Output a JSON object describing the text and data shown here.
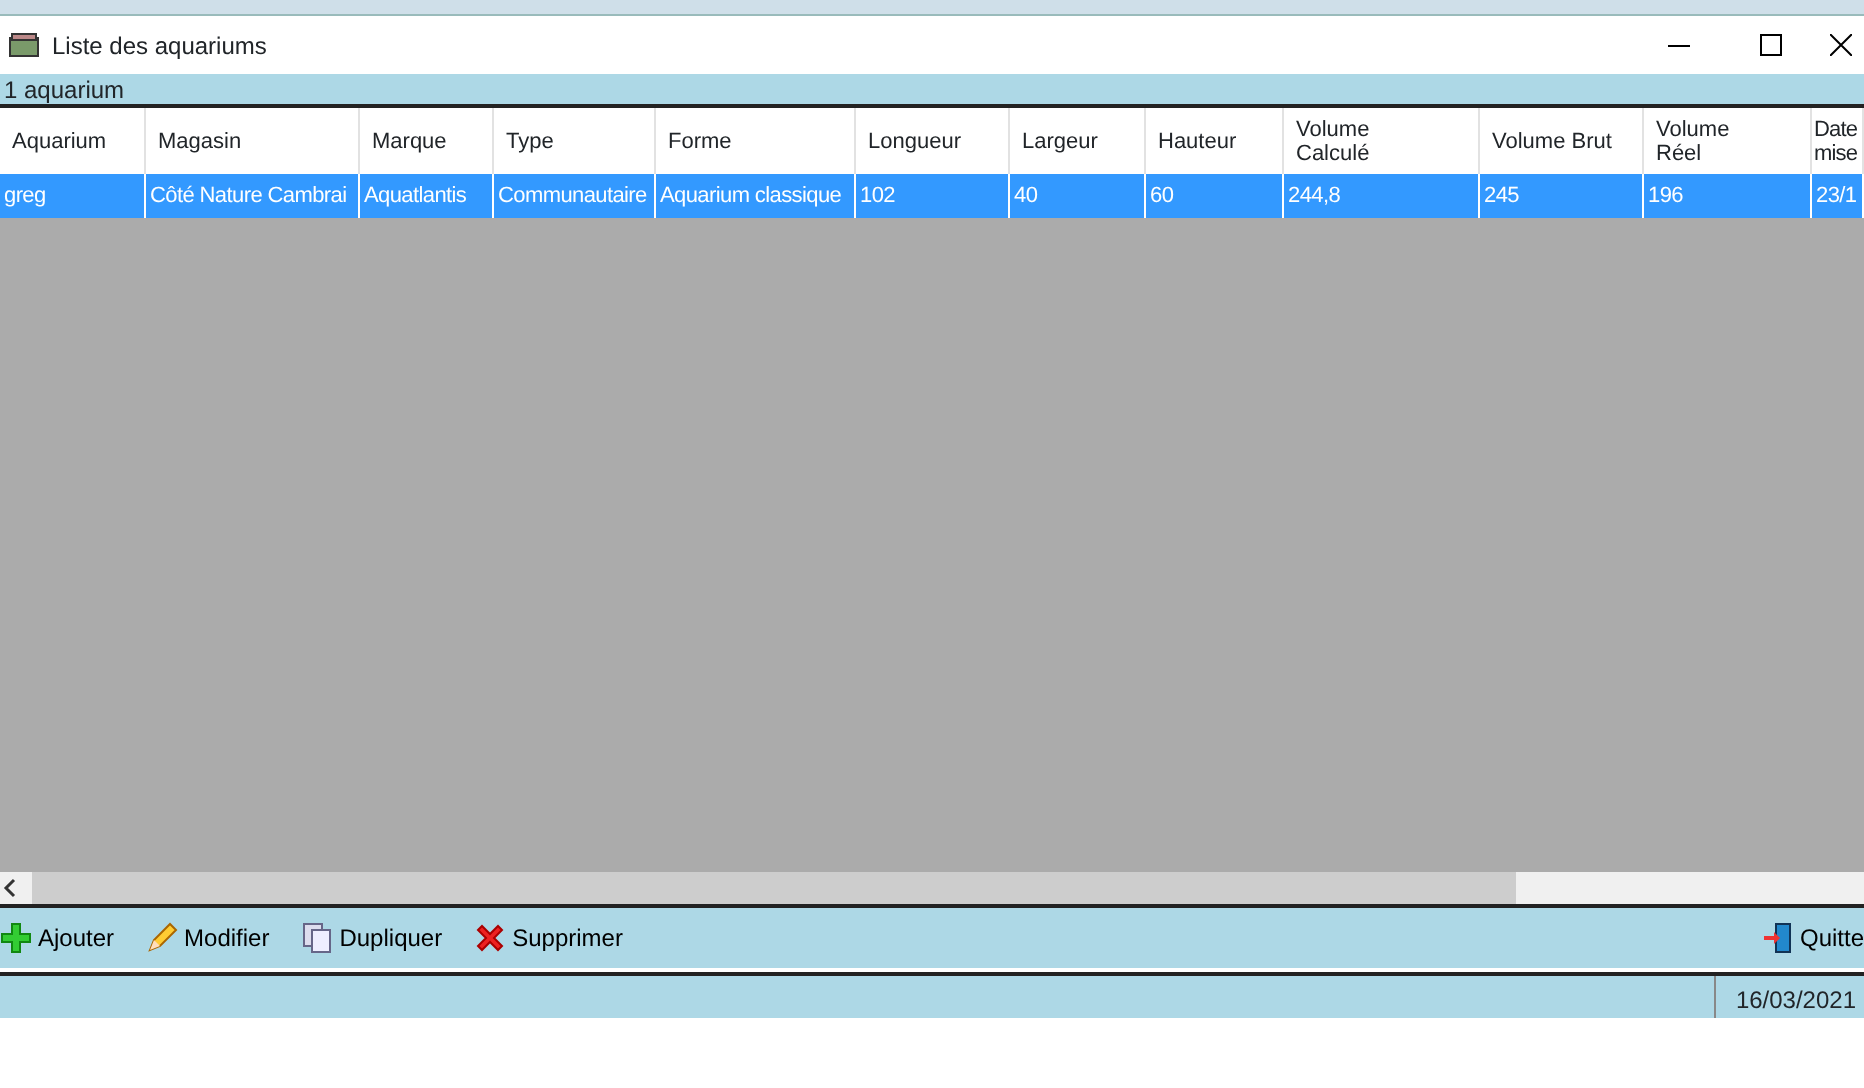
{
  "window": {
    "title": "Liste des aquariums"
  },
  "count_label": "1 aquarium",
  "table": {
    "columns": [
      "Aquarium",
      "Magasin",
      "Marque",
      "Type",
      "Forme",
      "Longueur",
      "Largeur",
      "Hauteur",
      "Volume Calculé",
      "Volume Brut",
      "Volume Réel",
      "Date mise"
    ],
    "rows": [
      {
        "selected": true,
        "cells": [
          "greg",
          "Côté Nature Cambrai",
          "Aquatlantis",
          "Communautaire",
          "Aquarium classique",
          "102",
          "40",
          "60",
          "244,8",
          "245",
          "196",
          "23/1"
        ]
      }
    ]
  },
  "toolbar": [
    {
      "kind": "add",
      "label": "Ajouter"
    },
    {
      "kind": "edit",
      "label": "Modifier"
    },
    {
      "kind": "copy",
      "label": "Dupliquer"
    },
    {
      "kind": "delete",
      "label": "Supprimer"
    },
    {
      "kind": "quit",
      "label": "Quitte"
    }
  ],
  "status_bar": {
    "date": "16/03/2021"
  }
}
